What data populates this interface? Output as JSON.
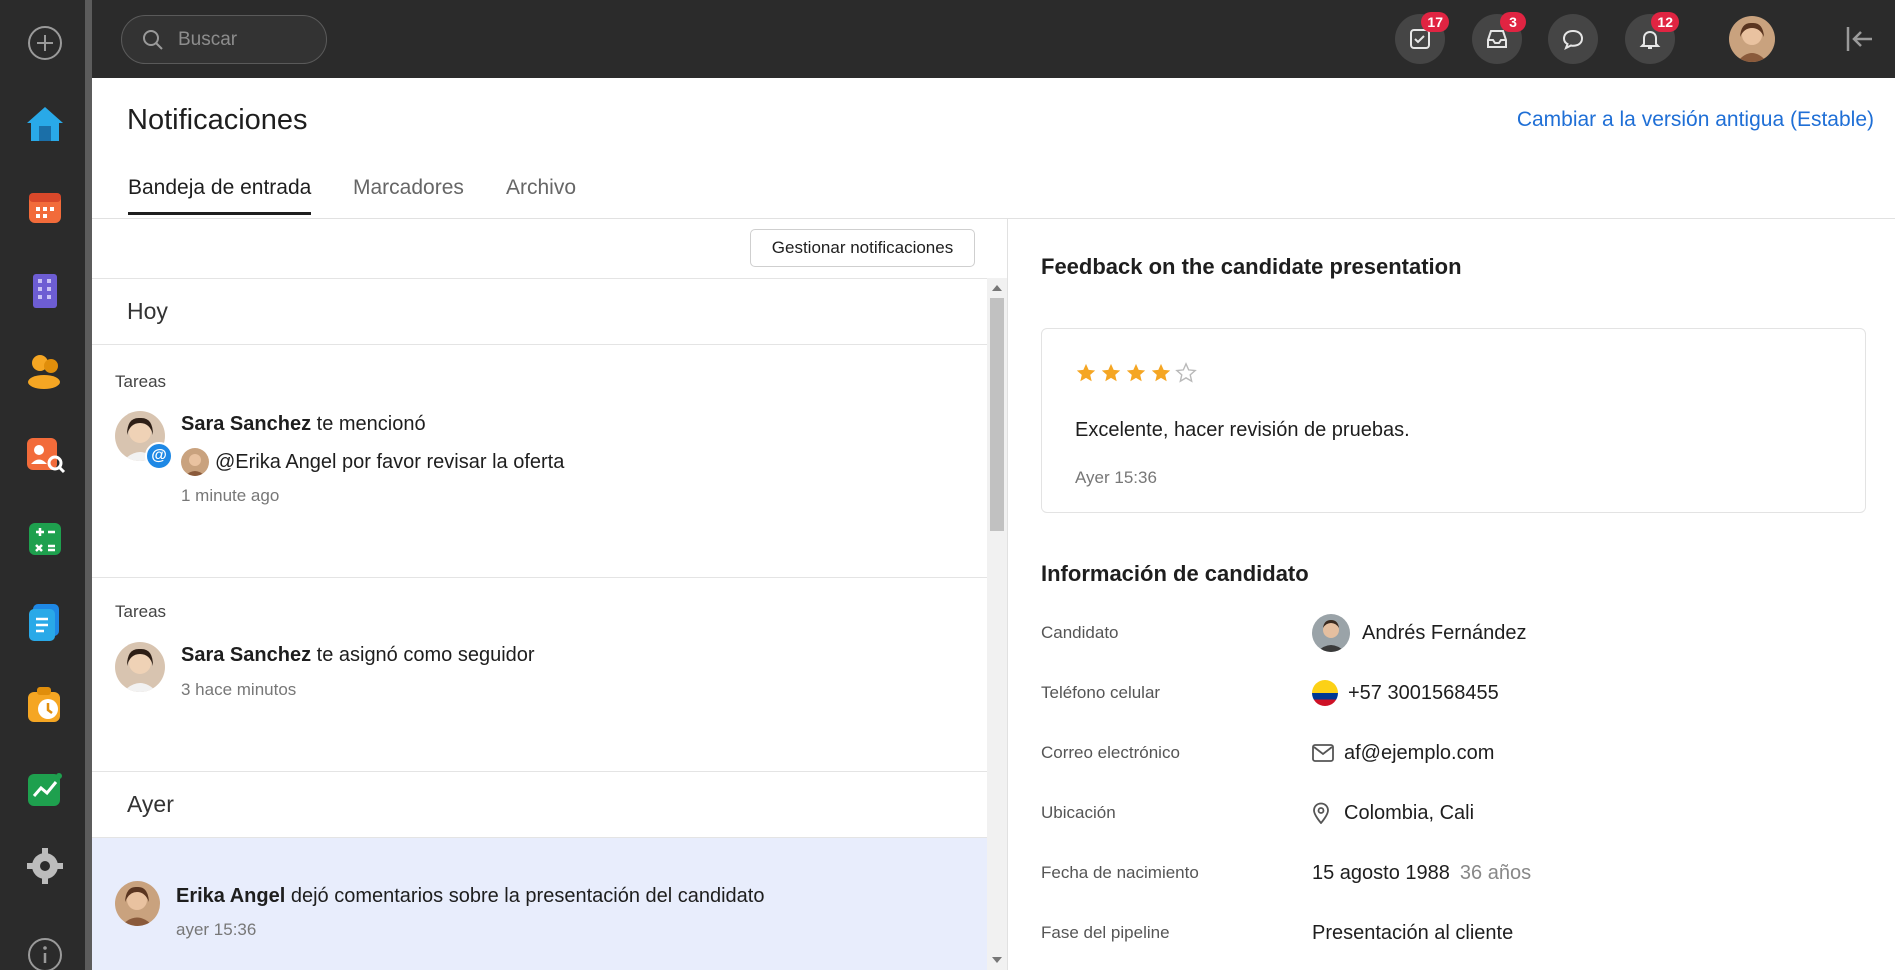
{
  "search": {
    "placeholder": "Buscar"
  },
  "topbar": {
    "badges": {
      "tasks": "17",
      "inbox": "3",
      "chat": "",
      "notifications": "12"
    }
  },
  "page": {
    "title": "Notificaciones",
    "switch_link": "Cambiar a la versión antigua (Estable)"
  },
  "tabs": [
    {
      "label": "Bandeja de entrada"
    },
    {
      "label": "Marcadores"
    },
    {
      "label": "Archivo"
    }
  ],
  "manage_button": "Gestionar notificaciones",
  "sections": {
    "today": "Hoy",
    "yesterday": "Ayer"
  },
  "notifications": [
    {
      "category": "Tareas",
      "actor": "Sara Sanchez",
      "action": " te mencionó",
      "detail": "@Erika Angel por favor revisar la oferta",
      "time": "1 minute ago"
    },
    {
      "category": "Tareas",
      "actor": "Sara Sanchez",
      "action": " te asignó como seguidor",
      "time": "3 hace minutos"
    },
    {
      "actor": "Erika Angel",
      "action": " dejó comentarios sobre la presentación del candidato",
      "time": "ayer 15:36"
    }
  ],
  "feedback": {
    "title": "Feedback on the candidate presentation",
    "rating": 4,
    "max_rating": 5,
    "text": "Excelente, hacer revisión de pruebas.",
    "time": "Ayer 15:36"
  },
  "candidate_info": {
    "title": "Información de candidato",
    "rows": [
      {
        "label": "Candidato",
        "value": "Andrés Fernández"
      },
      {
        "label": "Teléfono celular",
        "value": "+57 3001568455"
      },
      {
        "label": "Correo electrónico",
        "value": "af@ejemplo.com"
      },
      {
        "label": "Ubicación",
        "value": "Colombia, Cali"
      },
      {
        "label": "Fecha de nacimiento",
        "value": "15 agosto 1988",
        "extra": "36 años"
      },
      {
        "label": "Fase del pipeline",
        "value": "Presentación al cliente"
      }
    ]
  },
  "colors": {
    "accent_link": "#1f6fd6",
    "badge": "#e02442",
    "star": "#f5a623",
    "highlight_row": "#e8edfc",
    "dark_chrome": "#2b2b2b"
  }
}
